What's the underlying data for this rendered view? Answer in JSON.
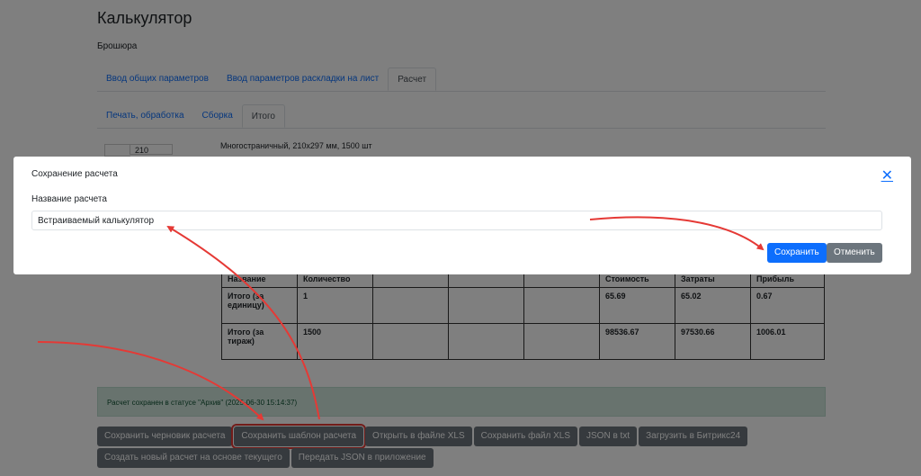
{
  "page": {
    "title": "Калькулятор",
    "subtitle": "Брошюра",
    "tabs_top": [
      "Ввод общих параметров",
      "Ввод параметров раскладки на лист",
      "Расчет"
    ],
    "tabs_sub": [
      "Печать, обработка",
      "Сборка",
      "Итого"
    ],
    "thumb_value": "210",
    "description": "Многостраничный, 210x297 мм, 1500 шт"
  },
  "table": {
    "headers": [
      "Название",
      "Количество",
      "",
      "",
      "",
      "Стоимость",
      "Затраты",
      "Прибыль"
    ],
    "rows": [
      [
        "Итого (за единицу)",
        "1",
        "",
        "",
        "",
        "65.69",
        "65.02",
        "0.67"
      ],
      [
        "Итого (за тираж)",
        "1500",
        "",
        "",
        "",
        "98536.67",
        "97530.66",
        "1006.01"
      ]
    ]
  },
  "status_message": "Расчет сохранен в статусе \"Архив\" (2025-06-30 15:14:37)",
  "buttons_row1": [
    "Сохранить черновик расчета",
    "Сохранить шаблон расчета",
    "Открыть в файле XLS",
    "Сохранить файл XLS",
    "JSON в txt",
    "Загрузить в Битрикс24"
  ],
  "buttons_row2": [
    "Создать новый расчет на основе текущего",
    "Передать JSON в приложение"
  ],
  "modal": {
    "title": "Сохранение расчета",
    "close_icon": "close-icon",
    "field_label": "Название расчета",
    "field_value": "Встраиваемый калькулятор",
    "save_label": "Сохранить",
    "cancel_label": "Отменить"
  },
  "colors": {
    "primary": "#0d6efd",
    "secondary": "#6c757d",
    "annotation": "#e53935",
    "success_bg": "#d1e7dd"
  }
}
